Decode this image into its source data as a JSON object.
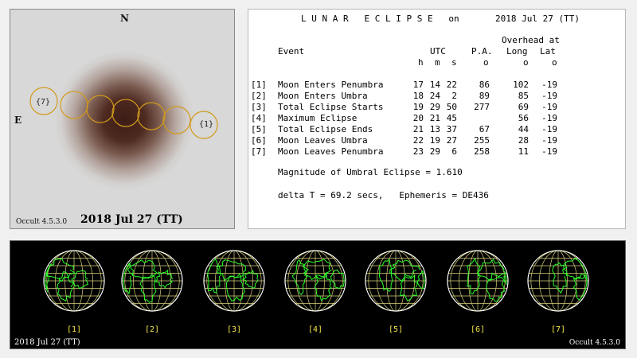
{
  "diagram": {
    "north_label": "N",
    "east_label": "E",
    "contact_labels": [
      "{7}",
      "{1}"
    ],
    "software": "Occult 4.5.3.0",
    "date": "2018 Jul 27 (TT)",
    "colors": {
      "umbra": "#3b1c15",
      "penumbra": "#dadada",
      "moon_outline": "#d19a1a"
    }
  },
  "data_panel": {
    "title": "L U N A R   E C L I P S E   on",
    "title_date": "2018 Jul 27 (TT)",
    "header": {
      "overhead": "Overhead at",
      "event": "Event",
      "utc": "UTC",
      "pa": "P.A.",
      "long": "Long",
      "lat": "Lat",
      "h": "h",
      "m": "m",
      "s": "s",
      "deg_pa": "o",
      "deg_long": "o",
      "deg_lat": "o"
    },
    "events": [
      {
        "num": "[1]",
        "name": "Moon Enters Penumbra",
        "h": "17",
        "m": "14",
        "s": "22",
        "pa": "86",
        "long": "102",
        "lat": "-19"
      },
      {
        "num": "[2]",
        "name": "Moon Enters Umbra",
        "h": "18",
        "m": "24",
        "s": "2",
        "pa": "89",
        "long": "85",
        "lat": "-19"
      },
      {
        "num": "[3]",
        "name": "Total Eclipse Starts",
        "h": "19",
        "m": "29",
        "s": "50",
        "pa": "277",
        "long": "69",
        "lat": "-19"
      },
      {
        "num": "[4]",
        "name": "Maximum Eclipse",
        "h": "20",
        "m": "21",
        "s": "45",
        "pa": "",
        "long": "56",
        "lat": "-19"
      },
      {
        "num": "[5]",
        "name": "Total Eclipse Ends",
        "h": "21",
        "m": "13",
        "s": "37",
        "pa": "67",
        "long": "44",
        "lat": "-19"
      },
      {
        "num": "[6]",
        "name": "Moon Leaves Umbra",
        "h": "22",
        "m": "19",
        "s": "27",
        "pa": "255",
        "long": "28",
        "lat": "-19"
      },
      {
        "num": "[7]",
        "name": "Moon Leaves Penumbra",
        "h": "23",
        "m": "29",
        "s": "6",
        "pa": "258",
        "long": "11",
        "lat": "-19"
      }
    ],
    "magnitude": "Magnitude of Umbral Eclipse = 1.610",
    "delta_t": "delta T = 69.2 secs,   Ephemeris = DE436"
  },
  "globes": {
    "labels": [
      "[1]",
      "[2]",
      "[3]",
      "[4]",
      "[5]",
      "[6]",
      "[7]"
    ],
    "date": "2018 Jul 27 (TT)",
    "software": "Occult 4.5.3.0",
    "colors": {
      "coast": "#2cff2c",
      "grid": "#d7d27a",
      "background": "#000000"
    }
  }
}
